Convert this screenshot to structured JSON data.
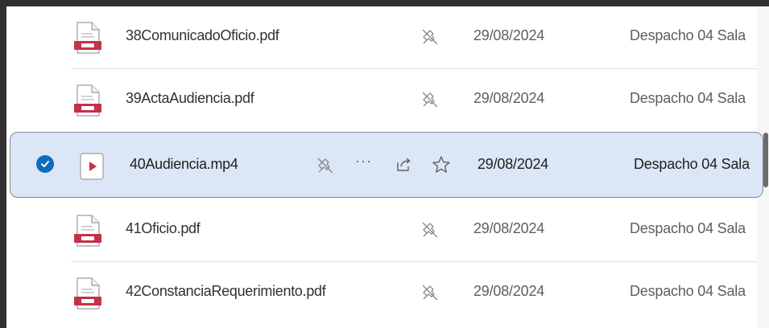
{
  "files": [
    {
      "name": "38ComunicadoOficio.pdf",
      "type": "pdf",
      "date": "29/08/2024",
      "location": "Despacho 04 Sala",
      "selected": false
    },
    {
      "name": "39ActaAudiencia.pdf",
      "type": "pdf",
      "date": "29/08/2024",
      "location": "Despacho 04 Sala",
      "selected": false
    },
    {
      "name": "40Audiencia.mp4",
      "type": "video",
      "date": "29/08/2024",
      "location": "Despacho 04 Sala",
      "selected": true,
      "actions": [
        "pin-icon",
        "more-icon",
        "share-icon",
        "star-icon"
      ],
      "more_glyph": "···"
    },
    {
      "name": "41Oficio.pdf",
      "type": "pdf",
      "date": "29/08/2024",
      "location": "Despacho 04 Sala",
      "selected": false
    },
    {
      "name": "42ConstanciaRequerimiento.pdf",
      "type": "pdf",
      "date": "29/08/2024",
      "location": "Despacho 04 Sala",
      "selected": false
    }
  ],
  "colors": {
    "accent": "#0f6cbd",
    "selected_bg": "#dbe7f7",
    "pdf_red": "#c4314b",
    "video_red": "#c4314b"
  }
}
